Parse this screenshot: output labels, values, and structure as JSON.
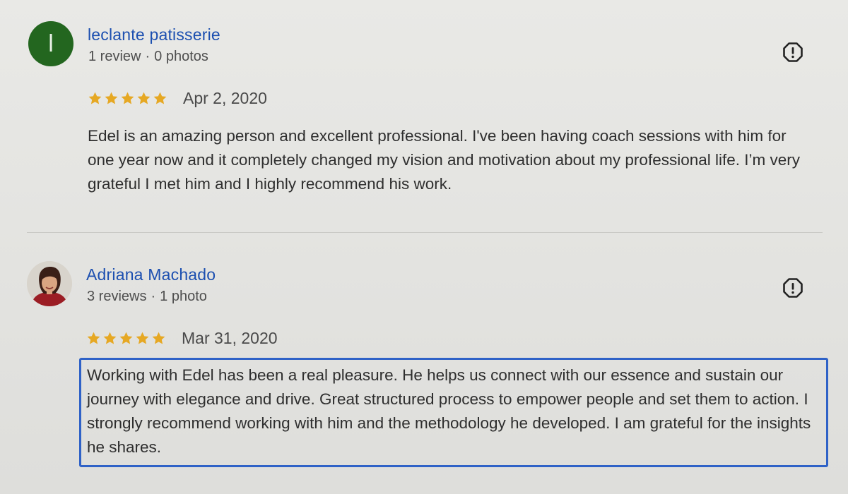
{
  "colors": {
    "reviewer_name": "#1c4fb0",
    "star": "#e6a823",
    "avatar_letter_bg": "#23661f",
    "highlight_border": "#2f62c7"
  },
  "reviews": [
    {
      "avatar_letter": "l",
      "avatar_icon": "letter-avatar",
      "name": "leclante patisserie",
      "review_count": "1 review",
      "separator": "·",
      "photo_count": "0 photos",
      "rating": 5,
      "date": "Apr 2, 2020",
      "text": "Edel is an amazing person and excellent professional. I've been having coach sessions with him for one year now and it completely changed my vision and motivation about my professional life. I’m very grateful I met him and I highly recommend his work.",
      "flag_icon": "report-icon"
    },
    {
      "avatar_icon": "profile-photo",
      "name": "Adriana Machado",
      "review_count": "3 reviews",
      "separator": "·",
      "photo_count": "1 photo",
      "rating": 5,
      "date": "Mar 31, 2020",
      "text": "Working with Edel has been a real pleasure. He helps us connect with our essence and sustain our journey with elegance and drive. Great structured process to empower people and set them to action. I strongly recommend working with him and the methodology he developed. I am grateful for the insights he shares.",
      "flag_icon": "report-icon",
      "text_selected": true
    }
  ]
}
